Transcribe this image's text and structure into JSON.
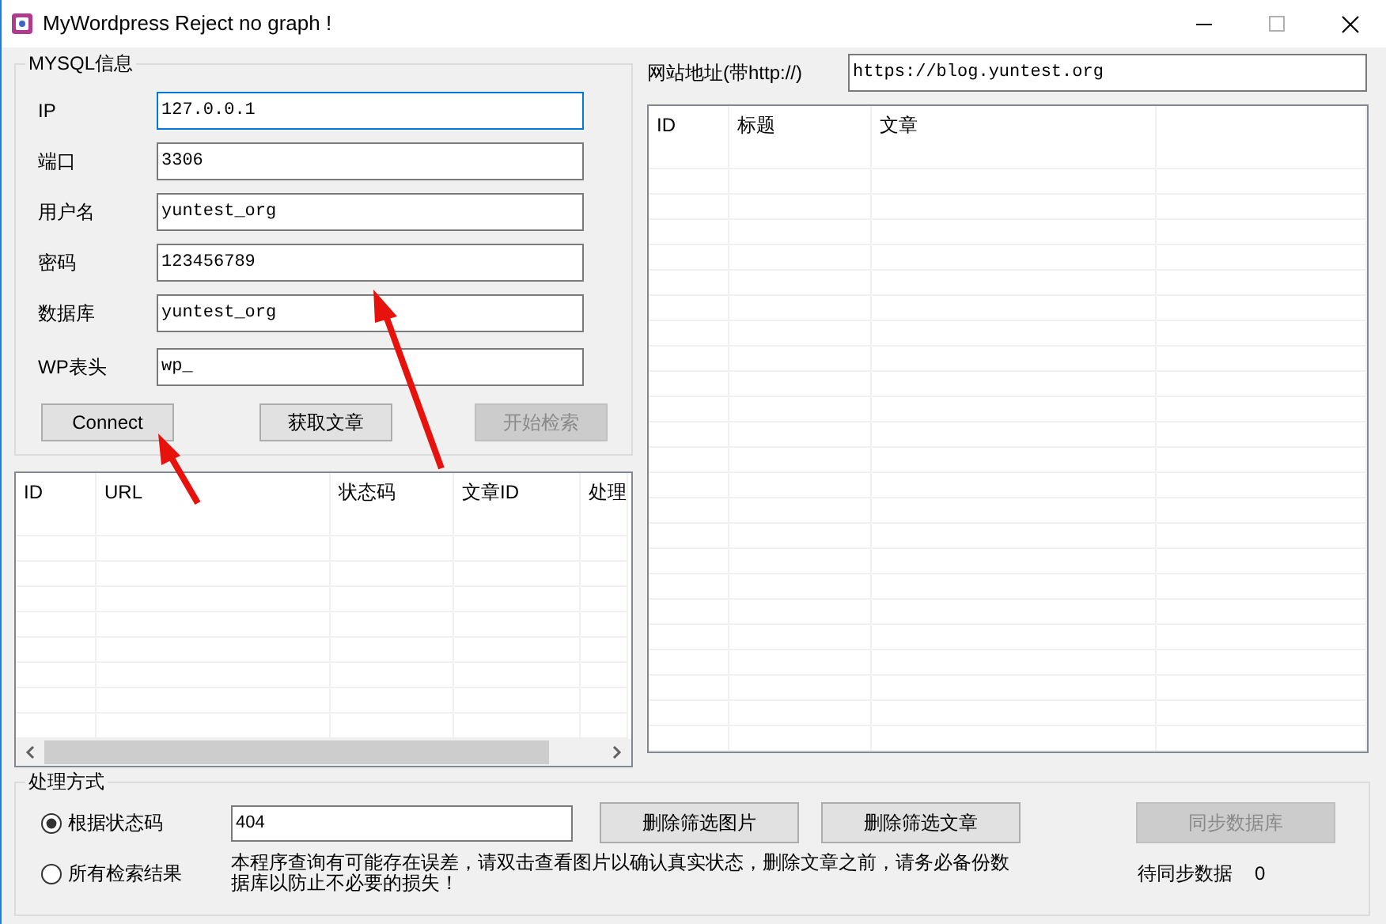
{
  "window": {
    "title": "MyWordpress Reject no graph !"
  },
  "mysql_group": {
    "title": "MYSQL信息",
    "fields": [
      {
        "label": "IP",
        "value": "127.0.0.1",
        "focused": true
      },
      {
        "label": "端口",
        "value": "3306",
        "focused": false
      },
      {
        "label": "用户名",
        "value": "yuntest_org",
        "focused": false
      },
      {
        "label": "密码",
        "value": "123456789",
        "focused": false
      },
      {
        "label": "数据库",
        "value": "yuntest_org",
        "focused": false
      },
      {
        "label": "WP表头",
        "value": "wp_",
        "focused": false
      }
    ],
    "buttons": [
      {
        "label": "Connect",
        "disabled": false
      },
      {
        "label": "获取文章",
        "disabled": false
      },
      {
        "label": "开始检索",
        "disabled": true
      }
    ]
  },
  "results_table": {
    "columns": [
      "ID",
      "URL",
      "状态码",
      "文章ID",
      "处理"
    ]
  },
  "site": {
    "label": "网站地址(带http://)",
    "value": "https://blog.yuntest.org"
  },
  "articles_table": {
    "columns": [
      "ID",
      "标题",
      "文章"
    ]
  },
  "mode_group": {
    "title": "处理方式",
    "options": [
      {
        "label": "根据状态码",
        "selected": true
      },
      {
        "label": "所有检索结果",
        "selected": false
      }
    ],
    "status_code": "404",
    "buttons": [
      {
        "label": "删除筛选图片",
        "disabled": false
      },
      {
        "label": "删除筛选文章",
        "disabled": false
      },
      {
        "label": "同步数据库",
        "disabled": true
      }
    ],
    "note": "本程序查询有可能存在误差，请双击查看图片以确认真实状态，删除文章之前，请务必备份数据库以防止不必要的损失！",
    "pending_label": "待同步数据",
    "pending_count": "0"
  }
}
